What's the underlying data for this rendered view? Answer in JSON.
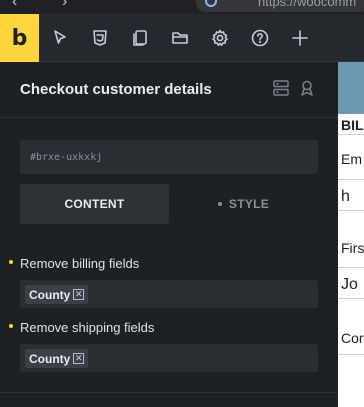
{
  "browser": {
    "url_text": "https://woocomm"
  },
  "toolbar": {
    "logo": "b",
    "icons": [
      "pointer-icon",
      "css3-icon",
      "pages-icon",
      "folder-icon",
      "gear-icon",
      "help-icon",
      "plus-icon"
    ]
  },
  "panel": {
    "title": "Checkout customer details",
    "element_id_placeholder": "#brxe-uxkxkj",
    "tabs": {
      "content": "CONTENT",
      "style": "STYLE"
    },
    "controls": [
      {
        "label": "Remove billing fields",
        "tags": [
          "County"
        ]
      },
      {
        "label": "Remove shipping fields",
        "tags": [
          "County"
        ]
      }
    ]
  },
  "canvas_preview": {
    "texts": [
      "BIL",
      "Em",
      "h",
      "Firs",
      "Jo",
      "Con"
    ]
  },
  "colors": {
    "accent": "#ffd53e",
    "panel_bg": "#1e2124",
    "toolbar_bg": "#25282c",
    "preview_header": "#6e98b2"
  }
}
